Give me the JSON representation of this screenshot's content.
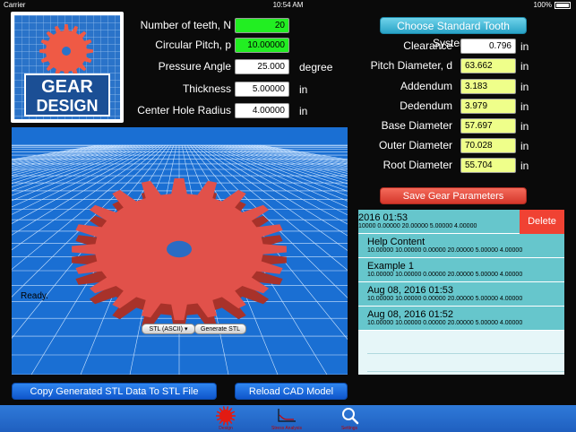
{
  "status": {
    "carrier": "Carrier",
    "time": "10:54 AM",
    "battery": "100%"
  },
  "logo": {
    "line1": "GEAR",
    "line2": "DESIGN"
  },
  "left_params": [
    {
      "label": "Number of teeth, N",
      "value": "20",
      "style": "green"
    },
    {
      "label": "Circular Pitch, p",
      "value": "10.00000",
      "style": "green"
    },
    {
      "label": "Pressure Angle",
      "value": "25.000",
      "unit": "degree"
    },
    {
      "label": "Thickness",
      "value": "5.00000",
      "unit": "in"
    },
    {
      "label": "Center Hole Radius",
      "value": "4.00000",
      "unit": "in"
    }
  ],
  "choose_button": "Choose Standard Tooth Systems",
  "right_params": [
    {
      "label": "Clearance",
      "value": "0.796",
      "unit": "in",
      "style": "white"
    },
    {
      "label": "Pitch Diameter, d",
      "value": "63.662",
      "unit": "in",
      "style": "yellow"
    },
    {
      "label": "Addendum",
      "value": "3.183",
      "unit": "in",
      "style": "yellow"
    },
    {
      "label": "Dedendum",
      "value": "3.979",
      "unit": "in",
      "style": "yellow"
    },
    {
      "label": "Base Diameter",
      "value": "57.697",
      "unit": "in",
      "style": "yellow"
    },
    {
      "label": "Outer Diameter",
      "value": "70.028",
      "unit": "in",
      "style": "yellow"
    },
    {
      "label": "Root Diameter",
      "value": "55.704",
      "unit": "in",
      "style": "yellow"
    }
  ],
  "save_button": "Save Gear Parameters",
  "viewport": {
    "status": "Ready.",
    "format_select": "STL (ASCII)",
    "generate_button": "Generate STL"
  },
  "saved_list": [
    {
      "title": "2016 01:53",
      "sub": "10000 0.00000 20.00000 5.00000 4.00000",
      "delete": "Delete"
    },
    {
      "title": "Help Content",
      "sub": "10.00000 10.00000 0.00000 20.00000 5.00000 4.00000"
    },
    {
      "title": "Example 1",
      "sub": "10.00000 10.00000 0.00000 20.00000 5.00000 4.00000"
    },
    {
      "title": "Aug 08, 2016 01:53",
      "sub": "10.00000 10.00000 0.00000 20.00000 5.00000 4.00000"
    },
    {
      "title": "Aug 08, 2016 01:52",
      "sub": "10.00000 10.00000 0.00000 20.00000 5.00000 4.00000"
    }
  ],
  "bottom_buttons": {
    "copy": "Copy Generated STL Data To STL File",
    "reload": "Reload CAD Model"
  },
  "tabs": [
    {
      "label": "Design",
      "icon": "gear-icon"
    },
    {
      "label": "Stress Analysis",
      "icon": "chart-icon"
    },
    {
      "label": "Settings",
      "icon": "search-icon"
    }
  ],
  "colors": {
    "accent_green": "#22ee22",
    "result_yellow": "#efff8a",
    "save_red": "#d5372b",
    "tab_blue": "#1f5fbf"
  }
}
